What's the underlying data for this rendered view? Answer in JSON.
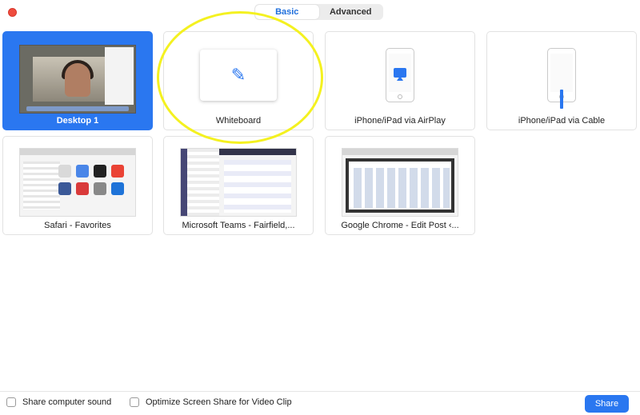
{
  "tabs": {
    "basic": "Basic",
    "advanced": "Advanced"
  },
  "sources": [
    {
      "label": "Desktop 1"
    },
    {
      "label": "Whiteboard"
    },
    {
      "label": "iPhone/iPad via AirPlay"
    },
    {
      "label": "iPhone/iPad via Cable"
    },
    {
      "label": "Safari - Favorites"
    },
    {
      "label": "Microsoft Teams - Fairfield,..."
    },
    {
      "label": "Google Chrome - Edit Post ‹..."
    }
  ],
  "footer": {
    "share_sound": "Share computer sound",
    "optimize": "Optimize Screen Share for Video Clip",
    "share_button": "Share"
  },
  "colors": {
    "accent": "#2a77f0",
    "highlight": "#f4f120"
  },
  "icons": {
    "whiteboard": "pencil-icon",
    "airplay": "airplay-icon",
    "cable": "lightning-cable-icon"
  }
}
